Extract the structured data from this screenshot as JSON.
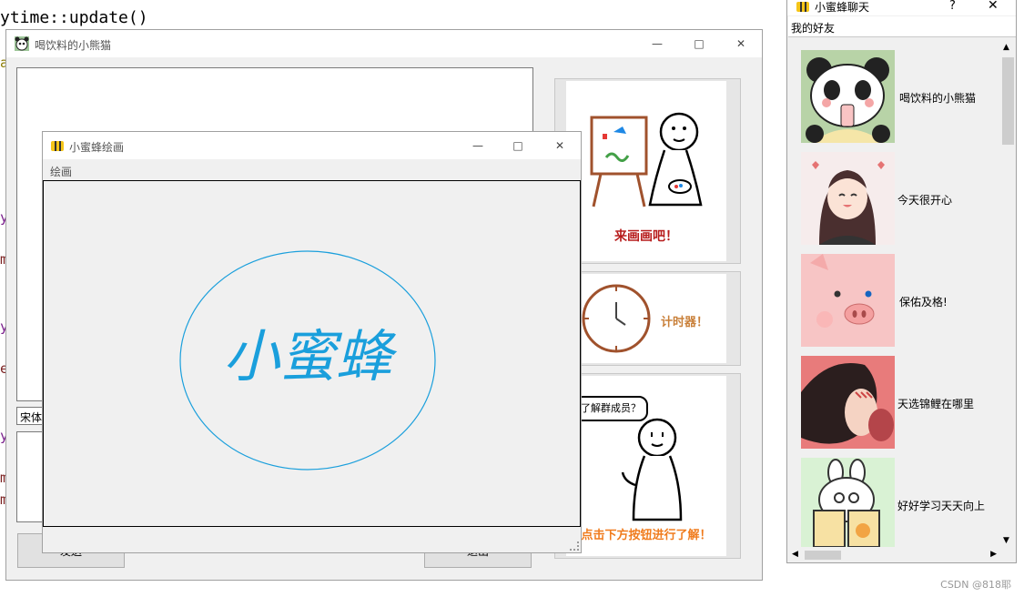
{
  "background_code": {
    "line1": "ytime::update()",
    "fragments": [
      "a",
      "y",
      "m",
      "y",
      "e",
      "y",
      "m",
      "m"
    ]
  },
  "chat_window": {
    "title": "喝饮料的小熊猫",
    "font_value": "宋体",
    "send_label": "发送",
    "exit_label": "退出",
    "side_cards": [
      {
        "caption": "来画画吧！"
      },
      {
        "caption": "计时器！"
      },
      {
        "bubble": "想要了解群成员？",
        "caption": "点击下方按钮进行了解！"
      }
    ]
  },
  "paint_window": {
    "title": "小蜜蜂绘画",
    "menu": "绘画",
    "canvas_text": "小蜜蜂"
  },
  "friends_window": {
    "title": "小蜜蜂聊天",
    "help": "?",
    "header": "我的好友",
    "friends": [
      {
        "name": "喝饮料的小熊猫"
      },
      {
        "name": "今天很开心"
      },
      {
        "name": "保佑及格!"
      },
      {
        "name": "天选锦鲤在哪里"
      },
      {
        "name": "好好学习天天向上"
      }
    ]
  },
  "watermark": "CSDN @818耶",
  "colors": {
    "accent_blue": "#1a9fdc",
    "red_caption": "#c0392b",
    "orange_caption": "#f07c1e"
  }
}
